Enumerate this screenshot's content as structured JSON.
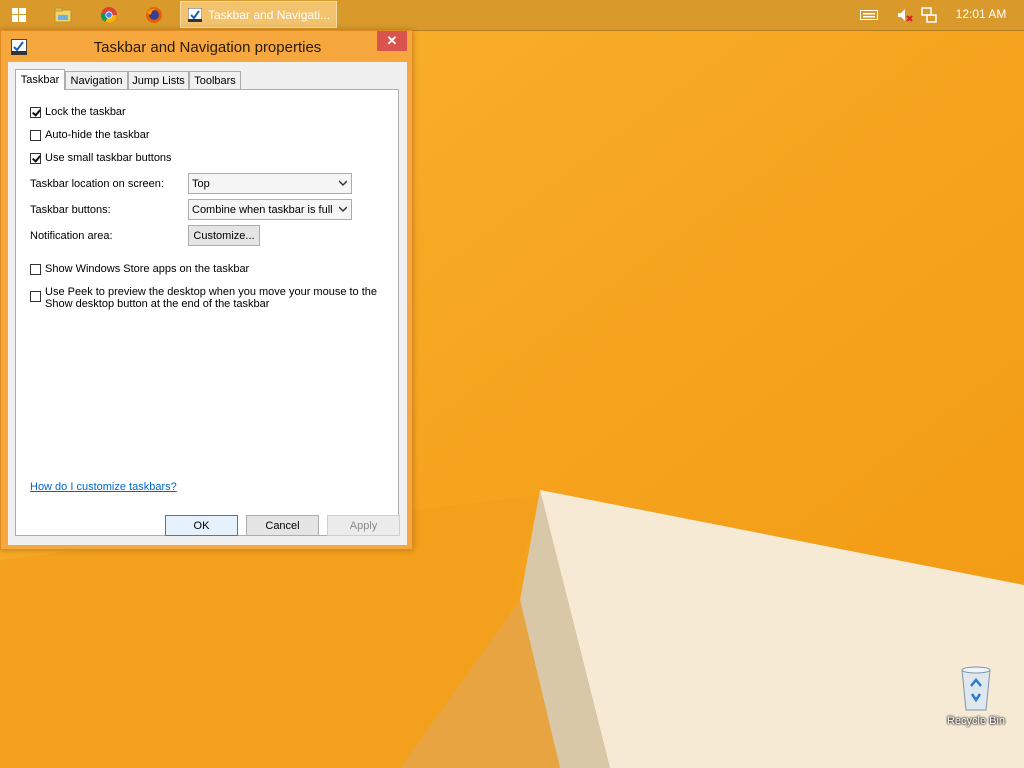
{
  "taskbar": {
    "start_icon": "windows-logo-icon",
    "pinned": [
      {
        "name": "file-explorer-icon"
      },
      {
        "name": "chrome-icon"
      },
      {
        "name": "firefox-icon"
      }
    ],
    "active_window_label": "Taskbar and Navigati...",
    "tray": [
      "keyboard-icon",
      "volume-muted-icon",
      "network-icon"
    ],
    "clock": "12:01 AM"
  },
  "dialog": {
    "title": "Taskbar and Navigation properties",
    "close_label": "✕",
    "tabs": [
      {
        "label": "Taskbar",
        "active": true
      },
      {
        "label": "Navigation",
        "active": false
      },
      {
        "label": "Jump Lists",
        "active": false
      },
      {
        "label": "Toolbars",
        "active": false
      }
    ],
    "options": {
      "lock": {
        "label": "Lock the taskbar",
        "checked": true
      },
      "autohide": {
        "label": "Auto-hide the taskbar",
        "checked": false
      },
      "small": {
        "label": "Use small taskbar buttons",
        "checked": true
      },
      "store": {
        "label": "Show Windows Store apps on the taskbar",
        "checked": false
      },
      "peek_line1": "Use Peek to preview the desktop when you move your mouse to the",
      "peek_line2": "Show desktop button at the end of the taskbar",
      "peek_checked": false
    },
    "location": {
      "label": "Taskbar location on screen:",
      "value": "Top"
    },
    "buttons_setting": {
      "label": "Taskbar buttons:",
      "value": "Combine when taskbar is full"
    },
    "notification": {
      "label": "Notification area:",
      "button": "Customize..."
    },
    "help_link": "How do I customize taskbars?",
    "ok": "OK",
    "cancel": "Cancel",
    "apply": "Apply"
  },
  "desktop": {
    "recycle_bin": "Recycle Bin"
  }
}
